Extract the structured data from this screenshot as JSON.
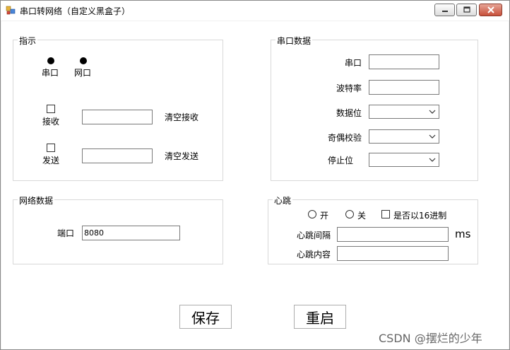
{
  "window": {
    "title": "串口转网络（自定义黑盒子）",
    "icons": {
      "app": "app-icon",
      "minimize": "minimize-icon",
      "maximize": "maximize-icon",
      "close": "close-icon"
    }
  },
  "indicator": {
    "title": "指示",
    "serial_label": "串口",
    "network_label": "网口",
    "receive_label": "接收",
    "receive_value": "",
    "clear_receive": "清空接收",
    "send_label": "发送",
    "send_value": "",
    "clear_send": "清空发送"
  },
  "serial": {
    "title": "串口数据",
    "port_label": "串口",
    "port_value": "",
    "baud_label": "波特率",
    "baud_value": "",
    "databits_label": "数据位",
    "databits_value": "",
    "parity_label": "奇偶校验",
    "parity_value": "",
    "stopbits_label": "停止位",
    "stopbits_value": ""
  },
  "network": {
    "title": "网络数据",
    "port_label": "端口",
    "port_value": "8080"
  },
  "heartbeat": {
    "title": "心跳",
    "on_label": "开",
    "off_label": "关",
    "hex_label": "是否以16进制",
    "interval_label": "心跳间隔",
    "interval_value": "",
    "interval_unit": "ms",
    "content_label": "心跳内容",
    "content_value": ""
  },
  "buttons": {
    "save": "保存",
    "restart": "重启"
  },
  "watermark": "CSDN @摆烂的少年"
}
